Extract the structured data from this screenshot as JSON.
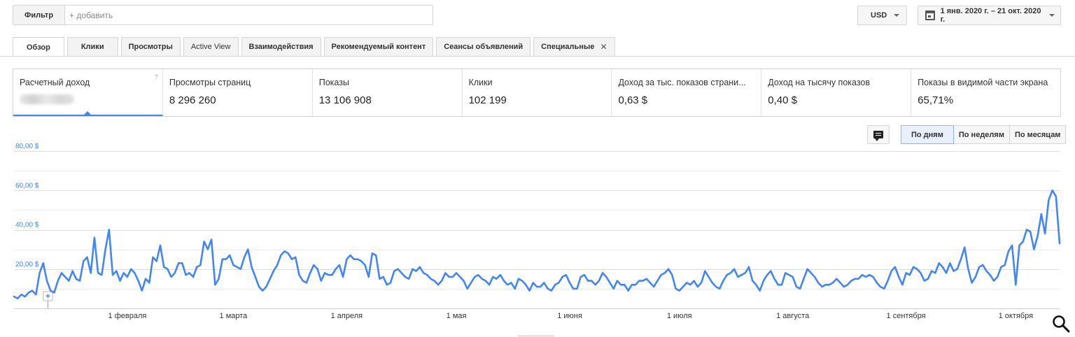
{
  "filter": {
    "label": "Фильтр",
    "placeholder": "+ добавить"
  },
  "currency": {
    "value": "USD"
  },
  "date_range": {
    "value": "1 янв. 2020 г. – 21 окт. 2020 г."
  },
  "tabs": [
    {
      "label": "Обзор"
    },
    {
      "label": "Клики"
    },
    {
      "label": "Просмотры"
    },
    {
      "label": "Active View"
    },
    {
      "label": "Взаимодействия"
    },
    {
      "label": "Рекомендуемый контент"
    },
    {
      "label": "Сеансы объявлений"
    },
    {
      "label": "Специальные"
    }
  ],
  "scorecards": [
    {
      "label": "Расчетный доход",
      "value": ""
    },
    {
      "label": "Просмотры страниц",
      "value": "8 296 260"
    },
    {
      "label": "Показы",
      "value": "13 106 908"
    },
    {
      "label": "Клики",
      "value": "102 199"
    },
    {
      "label": "Доход за тыс. показов страни...",
      "value": "0,63 $"
    },
    {
      "label": "Доход на тысячу показов",
      "value": "0,40 $"
    },
    {
      "label": "Показы в видимой части экрана",
      "value": "65,71%"
    }
  ],
  "period_buttons": [
    "По дням",
    "По неделям",
    "По месяцам"
  ],
  "icons": {
    "annotation": "comment-icon",
    "zoom": "search-icon",
    "help": "help-icon",
    "calendar": "calendar-icon"
  },
  "colors": {
    "series": "#4285f4",
    "accent": "#4285f4",
    "axis_label": "#4a86e8"
  },
  "chart_data": {
    "type": "line",
    "y_ticks": [
      "20,00 $",
      "40,00 $",
      "60,00 $",
      "80,00 $"
    ],
    "y_tick_values": [
      20,
      40,
      60,
      80
    ],
    "ylim": [
      0,
      80
    ],
    "x_ticks": [
      "1 февраля",
      "1 марта",
      "1 апреля",
      "1 мая",
      "1 июня",
      "1 июля",
      "1 августа",
      "1 сентября",
      "1 октября"
    ],
    "x_tick_days": [
      31,
      60,
      91,
      121,
      152,
      182,
      213,
      244,
      274
    ],
    "x_start": "2020-01-01",
    "x_end": "2020-10-21",
    "grid": true,
    "series": [
      {
        "values": [
          6,
          5,
          7,
          6,
          8,
          9,
          7,
          18,
          23,
          14,
          9,
          8,
          14,
          18,
          16,
          14,
          19,
          15,
          14,
          24,
          26,
          18,
          36,
          18,
          17,
          30,
          40,
          17,
          19,
          14,
          18,
          16,
          20,
          18,
          14,
          9,
          15,
          13,
          26,
          24,
          32,
          21,
          20,
          16,
          18,
          23,
          23,
          17,
          18,
          16,
          21,
          22,
          34,
          30,
          35,
          12,
          15,
          25,
          25,
          27,
          22,
          21,
          20,
          26,
          30,
          21,
          16,
          11,
          9,
          11,
          15,
          19,
          22,
          27,
          29,
          28,
          25,
          26,
          17,
          14,
          13,
          18,
          22,
          20,
          14,
          18,
          17,
          17,
          20,
          22,
          16,
          25,
          27,
          25,
          25,
          24,
          22,
          16,
          28,
          27,
          15,
          16,
          12,
          13,
          19,
          20,
          18,
          16,
          15,
          20,
          19,
          21,
          18,
          17,
          15,
          14,
          12,
          14,
          18,
          16,
          16,
          18,
          16,
          14,
          10,
          13,
          16,
          17,
          15,
          14,
          12,
          16,
          15,
          17,
          14,
          12,
          13,
          10,
          15,
          14,
          12,
          9,
          13,
          11,
          11,
          13,
          10,
          9,
          12,
          13,
          16,
          17,
          13,
          10,
          10,
          16,
          17,
          14,
          14,
          12,
          14,
          18,
          16,
          13,
          10,
          14,
          12,
          12,
          9,
          12,
          12,
          14,
          14,
          15,
          13,
          11,
          14,
          17,
          18,
          20,
          17,
          10,
          9,
          11,
          13,
          12,
          14,
          11,
          13,
          19,
          16,
          13,
          11,
          10,
          14,
          17,
          18,
          20,
          16,
          17,
          18,
          21,
          14,
          12,
          9,
          14,
          17,
          19,
          15,
          12,
          12,
          18,
          17,
          16,
          11,
          10,
          15,
          20,
          18,
          16,
          13,
          11,
          12,
          12,
          13,
          15,
          13,
          11,
          12,
          14,
          15,
          15,
          17,
          16,
          17,
          16,
          13,
          11,
          10,
          14,
          19,
          21,
          16,
          12,
          18,
          17,
          21,
          20,
          18,
          14,
          15,
          19,
          18,
          23,
          21,
          18,
          23,
          19,
          20,
          25,
          31,
          20,
          13,
          16,
          21,
          22,
          19,
          17,
          14,
          16,
          21,
          22,
          29,
          32,
          12,
          32,
          34,
          40,
          39,
          30,
          37,
          48,
          38,
          55,
          60,
          57,
          33
        ]
      }
    ]
  }
}
